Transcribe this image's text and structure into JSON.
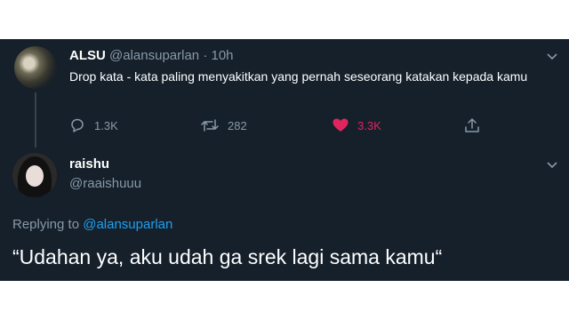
{
  "colors": {
    "background": "#15202b",
    "text": "#ffffff",
    "muted": "#8899a6",
    "link": "#1da1f2",
    "like": "#e0245e"
  },
  "tweet": {
    "name": "ALSU",
    "handle": "@alansuparlan",
    "separator": "·",
    "time": "10h",
    "text": "Drop kata - kata paling menyakitkan yang pernah seseorang katakan kepada kamu",
    "actions": {
      "reply_count": "1.3K",
      "retweet_count": "282",
      "like_count": "3.3K",
      "liked": true
    },
    "icons": [
      "chevron-down-icon",
      "reply-icon",
      "retweet-icon",
      "heart-icon",
      "share-icon"
    ]
  },
  "reply": {
    "name": "raishu",
    "handle": "@raaishuuu",
    "replying_prefix": "Replying to",
    "replying_to": "@alansuparlan",
    "text": "“Udahan ya, aku udah ga srek lagi sama kamu“"
  }
}
